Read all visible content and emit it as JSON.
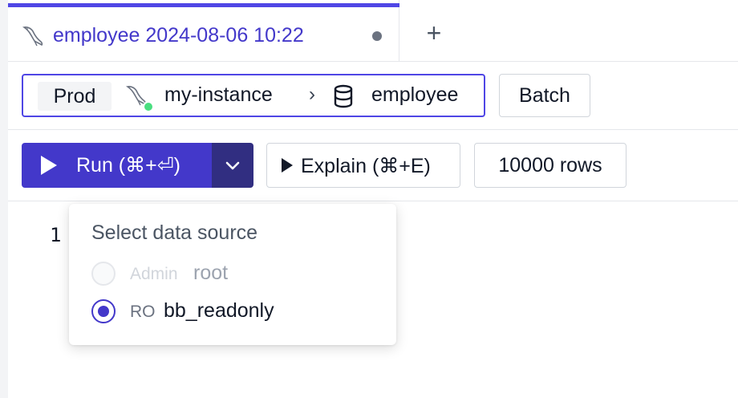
{
  "tab": {
    "title": "employee 2024-08-06 10:22",
    "add_label": "+",
    "accent_color": "#4f46e5",
    "icon": "mysql-dolphin-icon"
  },
  "context": {
    "environment": "Prod",
    "instance": "my-instance",
    "instance_icon": "mysql-dolphin-icon",
    "instance_status_color": "#4ade80",
    "separator": "›",
    "database": "employee",
    "database_icon": "database-icon",
    "batch_label": "Batch"
  },
  "toolbar": {
    "run_label": "Run (⌘+⏎)",
    "explain_label": "Explain (⌘+E)",
    "rows_label": "10000 rows",
    "run_color": "#4338ca"
  },
  "editor": {
    "line_numbers": [
      "1"
    ]
  },
  "datasource_popup": {
    "title": "Select data source",
    "options": [
      {
        "role": "Admin",
        "user": "root",
        "disabled": true,
        "selected": false
      },
      {
        "role": "RO",
        "user": "bb_readonly",
        "disabled": false,
        "selected": true
      }
    ]
  }
}
